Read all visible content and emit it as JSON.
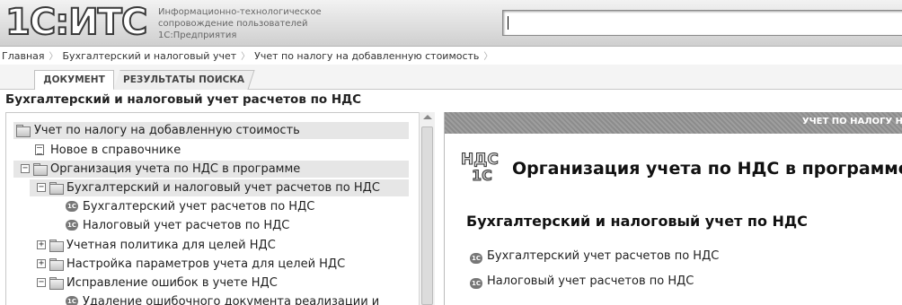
{
  "header": {
    "logo": "1С:ИТС",
    "tagline": [
      "Информационно-технологическое",
      "сопровождение пользователей",
      "1С:Предприятия"
    ],
    "search_value": ""
  },
  "breadcrumb": [
    "Главная",
    "Бухгалтерский и налоговый учет",
    "Учет по налогу на добавленную стоимость"
  ],
  "tabs": {
    "document": "ДОКУМЕНТ",
    "search_results": "РЕЗУЛЬТАТЫ ПОИСКА"
  },
  "section_title": "Бухгалтерский и налоговый учет расчетов по НДС",
  "tree": [
    {
      "label": "Учет по налогу на добавленную стоимость",
      "icon": "folder-icon",
      "toggle": ""
    },
    {
      "label": "Новое в справочнике",
      "icon": "document-icon",
      "toggle": ""
    },
    {
      "label": "Организация учета по НДС в программе",
      "icon": "folder-icon",
      "toggle": "−"
    },
    {
      "label": "Бухгалтерский и налоговый учет расчетов по НДС",
      "icon": "folder-icon",
      "toggle": "−"
    },
    {
      "label": "Бухгалтерский учет расчетов по НДС",
      "icon": "1c-icon",
      "toggle": ""
    },
    {
      "label": "Налоговый учет расчетов по НДС",
      "icon": "1c-icon",
      "toggle": ""
    },
    {
      "label": "Учетная политика для целей НДС",
      "icon": "folder-icon",
      "toggle": "+"
    },
    {
      "label": "Настройка параметров учета для целей НДС",
      "icon": "folder-icon",
      "toggle": "+"
    },
    {
      "label": "Исправление ошибок в учете НДС",
      "icon": "folder-icon",
      "toggle": "−"
    },
    {
      "label": "Удаление ошибочного документа реализации и",
      "icon": "1c-icon",
      "toggle": ""
    }
  ],
  "content": {
    "strip_title": "УЧЕТ ПО НАЛОГУ Н",
    "logo_text": "НДС",
    "logo_sub": "1С",
    "title": "Организация учета по НДС в программе",
    "subtitle": "Бухгалтерский и налоговый учет по НДС",
    "links": [
      "Бухгалтерский учет расчетов по НДС",
      "Налоговый учет расчетов по НДС"
    ],
    "icon_text": "1С"
  }
}
